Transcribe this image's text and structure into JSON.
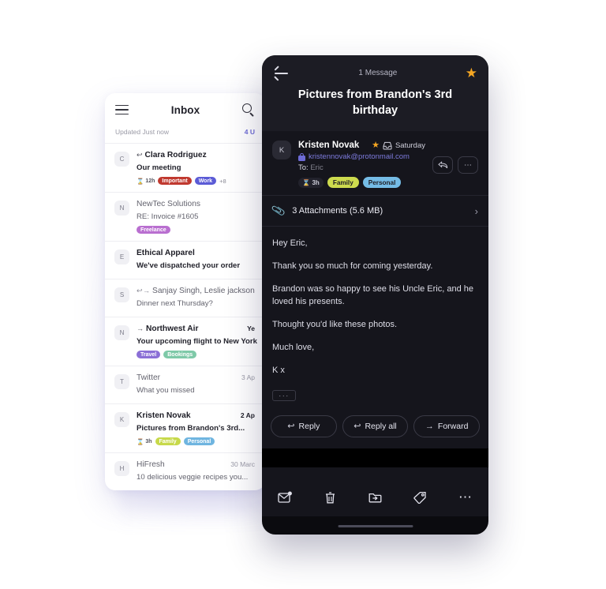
{
  "inbox": {
    "menu_icon": "hamburger-icon",
    "title": "Inbox",
    "search_icon": "search-icon",
    "updated_text": "Updated Just now",
    "unread_chip": "4 U",
    "rows": [
      {
        "avatar": "C",
        "arrows": "↩",
        "sender": "Clara Rodriguez",
        "subject": "Our meeting",
        "date": "",
        "unread": true,
        "expiry": "12h",
        "tags": [
          {
            "label": "Important",
            "color": "#c0392f"
          },
          {
            "label": "Work",
            "color": "#5b5bd6"
          }
        ],
        "extra": "+8"
      },
      {
        "avatar": "N",
        "arrows": "",
        "sender": "NewTec Solutions",
        "subject": "RE: Invoice #1605",
        "date": "",
        "unread": false,
        "expiry": "",
        "tags": [
          {
            "label": "Freelance",
            "color": "#b96fd0"
          }
        ],
        "extra": ""
      },
      {
        "avatar": "E",
        "arrows": "",
        "sender": "Ethical Apparel",
        "subject": "We've dispatched your order",
        "date": "",
        "unread": true,
        "expiry": "",
        "tags": [],
        "extra": ""
      },
      {
        "avatar": "S",
        "arrows": "↩ →",
        "sender": "Sanjay Singh, Leslie jackson",
        "subject": "Dinner next Thursday?",
        "date": "",
        "unread": false,
        "expiry": "",
        "tags": [],
        "extra": ""
      },
      {
        "avatar": "N",
        "arrows": "→",
        "sender": "Northwest Air",
        "subject": "Your upcoming flight to New York",
        "date": "Ye",
        "unread": true,
        "expiry": "",
        "tags": [
          {
            "label": "Travel",
            "color": "#8b6fd6"
          },
          {
            "label": "Bookings",
            "color": "#7ec9a8"
          }
        ],
        "extra": ""
      },
      {
        "avatar": "T",
        "arrows": "",
        "sender": "Twitter",
        "subject": "What you missed",
        "date": "3 Ap",
        "unread": false,
        "expiry": "",
        "tags": [],
        "extra": ""
      },
      {
        "avatar": "K",
        "arrows": "",
        "sender": "Kristen Novak",
        "subject": "Pictures from Brandon's 3rd...",
        "date": "2 Ap",
        "unread": true,
        "expiry": "3h",
        "tags": [
          {
            "label": "Family",
            "color": "#c7d94a"
          },
          {
            "label": "Personal",
            "color": "#6fb5e0"
          }
        ],
        "extra": ""
      },
      {
        "avatar": "H",
        "arrows": "",
        "sender": "HiFresh",
        "subject": "10 delicious veggie recipes you...",
        "date": "30 Marc",
        "unread": false,
        "expiry": "",
        "tags": [],
        "extra": ""
      }
    ]
  },
  "reader": {
    "back_icon": "back-arrow-icon",
    "message_count": "1 Message",
    "star_icon": "star-icon",
    "subject": "Pictures from Brandon's 3rd birthday",
    "sender": {
      "avatar": "K",
      "name": "Kristen Novak",
      "star_icon": "star-icon",
      "folder_icon": "inbox-icon",
      "date": "Saturday",
      "lock_icon": "lock-icon",
      "email": "kristennovak@protonmail.com",
      "to_label": "To:",
      "to_value": "Eric",
      "expiry": "3h",
      "tags": [
        {
          "label": "Family",
          "color": "#cddb4e"
        },
        {
          "label": "Personal",
          "color": "#75bce6"
        }
      ],
      "reply_icon": "reply-icon",
      "more_icon": "more-horizontal-icon"
    },
    "attachments": {
      "clip_icon": "paperclip-icon",
      "text": "3 Attachments (5.6 MB)",
      "chevron_icon": "chevron-right-icon"
    },
    "body": [
      "Hey Eric,",
      "Thank you so much for coming yesterday.",
      "Brandon was so happy to see his Uncle Eric, and he loved his presents.",
      "Thought you'd like these photos.",
      "Much love,",
      "K x"
    ],
    "expand_button": "···",
    "actions": [
      {
        "label": "Reply",
        "glyph": "↩",
        "icon": "reply-icon"
      },
      {
        "label": "Reply all",
        "glyph": "↩",
        "icon": "reply-all-icon"
      },
      {
        "label": "Forward",
        "glyph": "→",
        "icon": "forward-icon"
      }
    ],
    "toolbar": [
      {
        "icon": "mark-unread-icon"
      },
      {
        "icon": "trash-icon"
      },
      {
        "icon": "move-to-folder-icon"
      },
      {
        "icon": "label-tag-icon"
      },
      {
        "icon": "more-horizontal-icon"
      }
    ]
  },
  "colors": {
    "accent_purple": "#6d6bd6",
    "star_orange": "#f5a623",
    "dark_bg": "#15151c",
    "dark_header": "#1c1c24"
  }
}
